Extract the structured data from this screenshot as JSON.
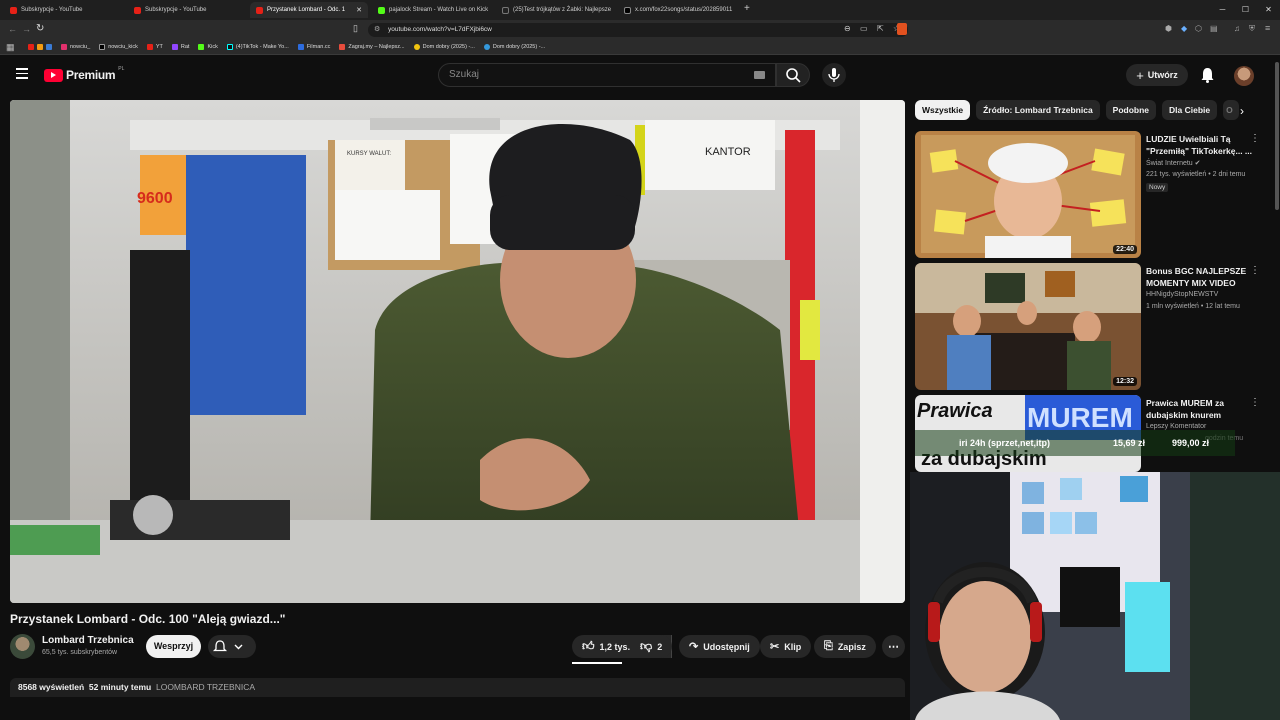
{
  "browser": {
    "tabs": [
      {
        "label": "Subskrypcje - YouTube",
        "active": false
      },
      {
        "label": "Subskrypcje - YouTube",
        "active": false
      },
      {
        "label": "Przystanek Lombard - Odc. 1",
        "active": true
      },
      {
        "label": "pajalock Stream - Watch Live on Kick",
        "active": false
      },
      {
        "label": "(25)Test trójkątów z Żabki: Najlepsze",
        "active": false
      },
      {
        "label": "x.com/fox22songs/status/202859011",
        "active": false
      }
    ],
    "url": "youtube.com/watch?v=L7dFXjbi6cw",
    "bookmarks": [
      "nowciu_",
      "nowciu_kick",
      "YT",
      "Rat",
      "Kick",
      "(4)TikTok - Make Yo...",
      "Filman.cc",
      "Zagraj.my – Najlepsz...",
      "Dom dobry (2025) -...",
      "Dom dobry (2025) -..."
    ]
  },
  "header": {
    "logo_text": "Premium",
    "logo_region": "PL",
    "search_placeholder": "Szukaj",
    "create_label": "Utwórz"
  },
  "video": {
    "title": "Przystanek Lombard - Odc. 100 \"Aleją gwiazd...\"",
    "channel_name": "Lombard Trzebnica",
    "channel_subs": "65,5 tys. subskrybentów",
    "support_label": "Wesprzyj",
    "likes": "1,2 tys.",
    "dislikes": "2",
    "share_label": "Udostępnij",
    "clip_label": "Klip",
    "save_label": "Zapisz",
    "views": "8568 wyświetleń",
    "age": "52 minuty temu",
    "tag": "LOOMBARD TRZEBNICA",
    "scene_text": {
      "kantor": "KANTOR",
      "kursy": "KURSY WALUT:",
      "price": "9600"
    }
  },
  "sidebar": {
    "chips": [
      "Wszystkie",
      "Źródło: Lombard Trzebnica",
      "Podobne",
      "Dla Ciebie",
      "O"
    ],
    "recommendations": [
      {
        "title": "LUDZIE Uwielbiali Tą \"Przemiłą\" TikTokerkę... ...",
        "channel": "Świat Internetu",
        "meta": "221 tys. wyświetleń • 2 dni temu",
        "badge": "Nowy",
        "duration": "22:40"
      },
      {
        "title": "Bonus BGC NAJLEPSZE MOMENTY MIX VIDEO",
        "channel": "HHNigdyStopNEWSTV",
        "meta": "1 mln wyświetleń • 12 lat temu",
        "badge": "",
        "duration": "12:32"
      },
      {
        "title": "Prawica MUREM za dubajskim knurem",
        "channel": "Lepszy Komentator",
        "meta": "godzin temu",
        "badge": "",
        "duration": ""
      }
    ]
  },
  "stream_overlay": {
    "goal_text": "iri 24h (sprzet,net,itp)",
    "amount_1": "15,69 zł",
    "amount_2": "999,00 zł",
    "thumb3_text_1": "Prawica",
    "thumb3_text_2": "MUREM",
    "thumb3_text_3": "za dubajskim"
  }
}
